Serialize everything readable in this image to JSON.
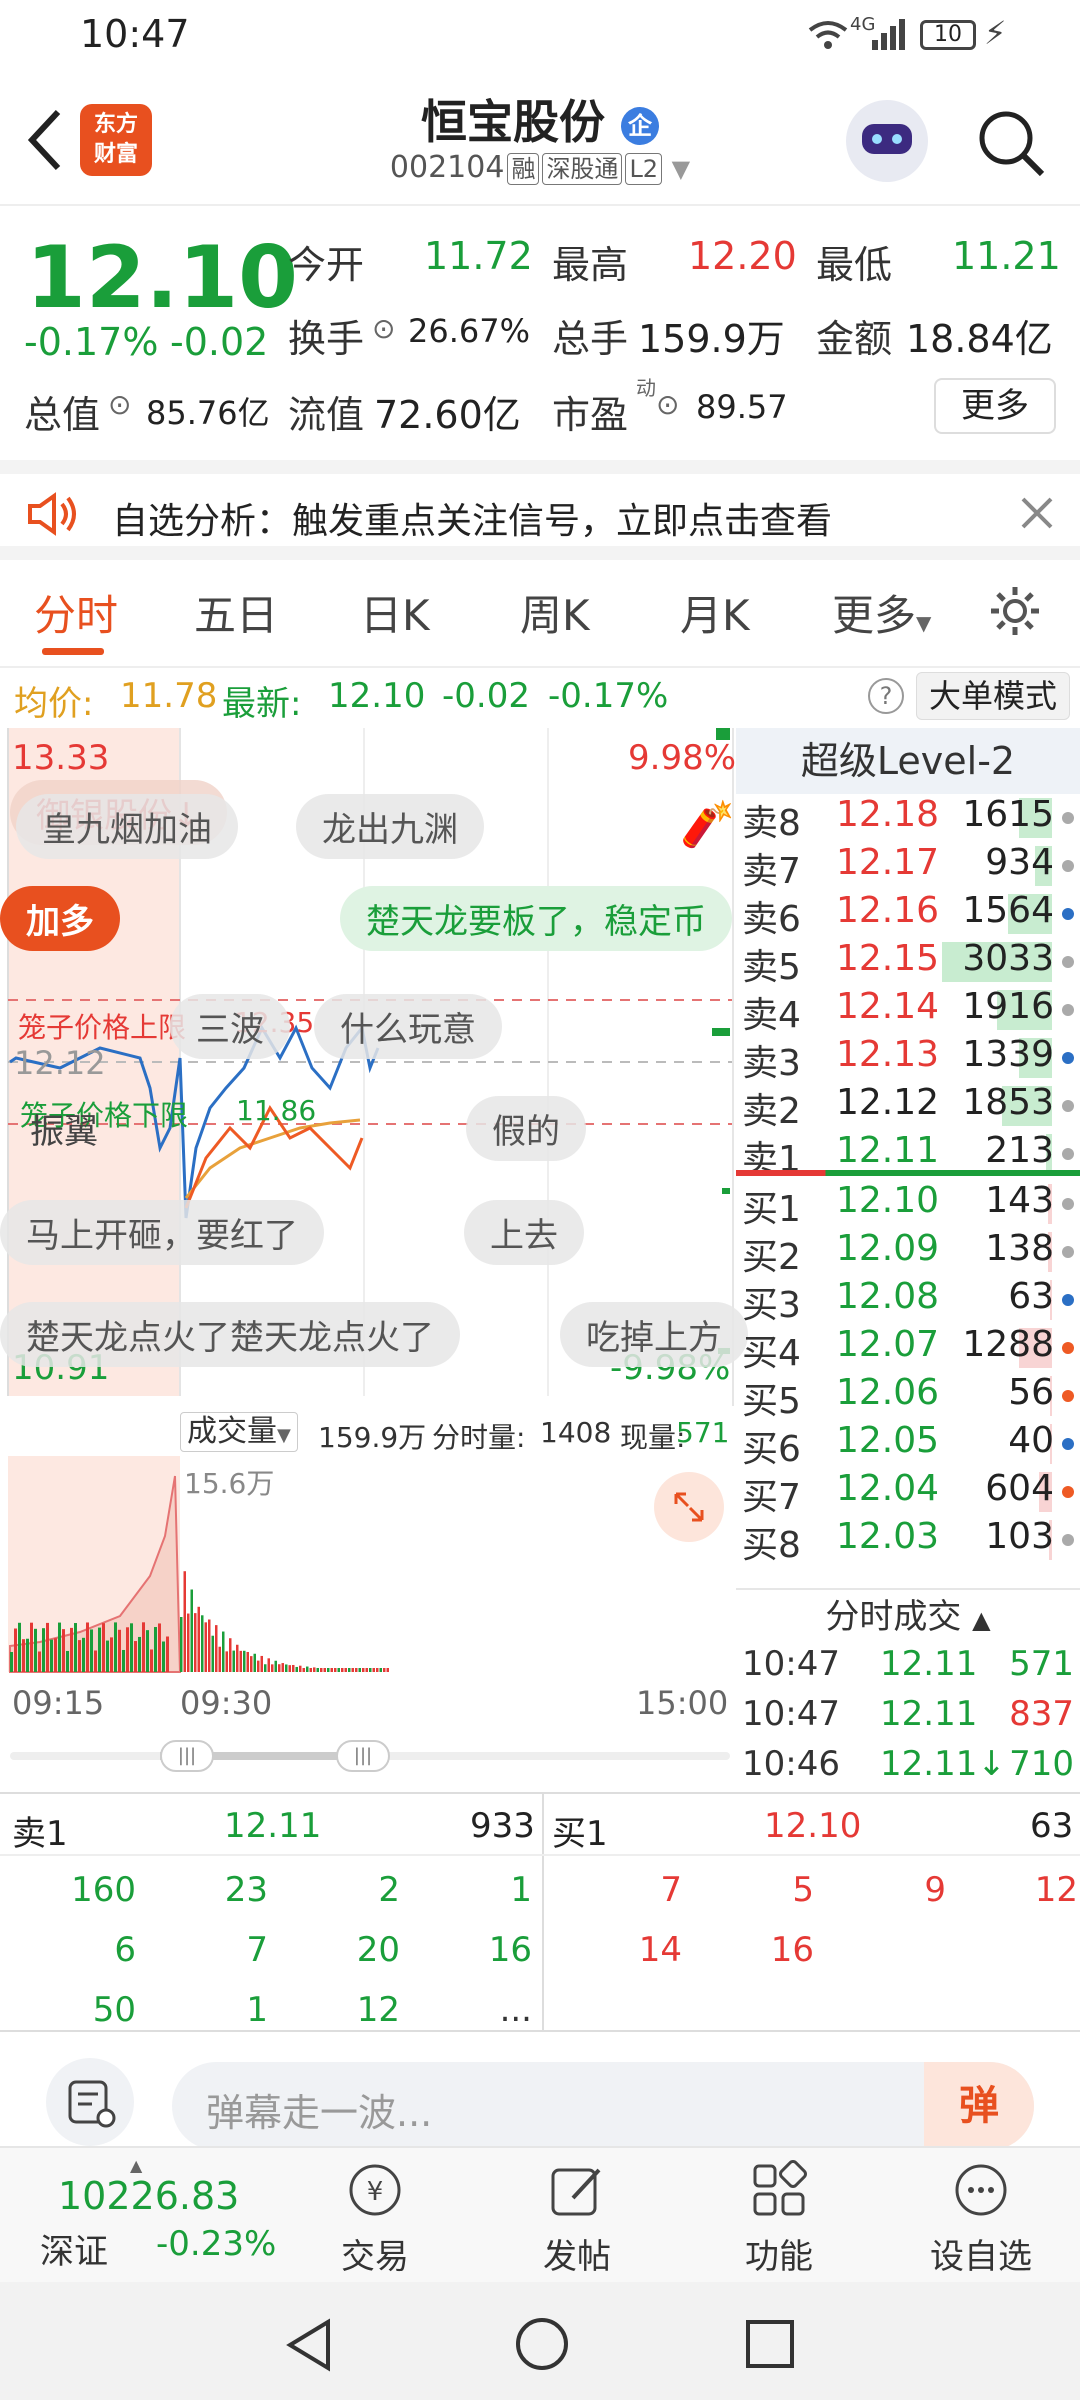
{
  "status_bar": {
    "time": "10:47",
    "network": "4G",
    "battery": "10"
  },
  "header": {
    "logo_text_1": "东方",
    "logo_text_2": "财富",
    "stock_name": "恒宝股份",
    "stock_badge": "企",
    "stock_code": "002104",
    "tags": [
      "融",
      "深股通",
      "L2"
    ]
  },
  "quote": {
    "price": "12.10",
    "change_pct": "-0.17%",
    "change": "-0.02",
    "open_label": "今开",
    "open": "11.72",
    "high_label": "最高",
    "high": "12.20",
    "low_label": "最低",
    "low": "11.21",
    "turnover_label": "换手",
    "turnover": "26.67%",
    "volume_label": "总手",
    "volume": "159.9万",
    "amount_label": "金额",
    "amount": "18.84亿",
    "mktcap_label": "总值",
    "mktcap": "85.76亿",
    "float_label": "流值",
    "float": "72.60亿",
    "pe_label": "市盈",
    "pe_sup": "动",
    "pe": "89.57",
    "more_button": "更多"
  },
  "banner": {
    "text": "自选分析：触发重点关注信号，立即点击查看"
  },
  "tabs": [
    "分时",
    "五日",
    "日K",
    "周K",
    "月K",
    "更多"
  ],
  "info_bar": {
    "avg_label": "均价:",
    "avg": "11.78",
    "latest_label": "最新:",
    "latest": "12.10",
    "latest_change": "-0.02",
    "latest_pct": "-0.17%",
    "mode_button": "大单模式"
  },
  "chart": {
    "top_price": "13.33",
    "top_pct": "9.98%",
    "bottom_price": "10.91",
    "bottom_pct": "-9.98%",
    "ref_price": "12.12",
    "upper_limit_label": "笼子价格上限",
    "upper_limit": "12.35",
    "lower_limit_label": "笼子价格下限",
    "lower_limit": "11.86",
    "danmu": [
      "御银股份↓",
      "皇九烟加油",
      "龙出九渊",
      "楚天龙要板了，稳定币",
      "加多",
      "三波",
      "什么玩意",
      "振翼",
      "假的",
      "马上开砸，要红了",
      "上去",
      "楚天龙点火了楚天龙点火了",
      "吃掉上方"
    ]
  },
  "volume_bar": {
    "label": "成交量",
    "total": "159.9万",
    "minute_label": "分时量:",
    "minute": "1408",
    "current_label": "现量:",
    "current": "571",
    "peak": "15.6万"
  },
  "time_axis": [
    "09:15",
    "09:30",
    "15:00"
  ],
  "level2": {
    "title": "超级Level-2",
    "asks": [
      {
        "label": "卖8",
        "price": "12.18",
        "qty": "1615",
        "share": 0.3
      },
      {
        "label": "卖7",
        "price": "12.17",
        "qty": "934",
        "share": 0.15
      },
      {
        "label": "卖6",
        "price": "12.16",
        "qty": "1564",
        "share": 0.4
      },
      {
        "label": "卖5",
        "price": "12.15",
        "qty": "3033",
        "share": 1.0
      },
      {
        "label": "卖4",
        "price": "12.14",
        "qty": "1916",
        "share": 0.5
      },
      {
        "label": "卖3",
        "price": "12.13",
        "qty": "1339",
        "share": 0.3
      },
      {
        "label": "卖2",
        "price": "12.12",
        "qty": "1853",
        "share": 0.45
      },
      {
        "label": "卖1",
        "price": "12.11",
        "qty": "213",
        "share": 0.05
      }
    ],
    "bids": [
      {
        "label": "买1",
        "price": "12.10",
        "qty": "143",
        "share": 0.04
      },
      {
        "label": "买2",
        "price": "12.09",
        "qty": "138",
        "share": 0.04
      },
      {
        "label": "买3",
        "price": "12.08",
        "qty": "63",
        "share": 0.02
      },
      {
        "label": "买4",
        "price": "12.07",
        "qty": "1288",
        "share": 0.3
      },
      {
        "label": "买5",
        "price": "12.06",
        "qty": "56",
        "share": 0.02
      },
      {
        "label": "买6",
        "price": "12.05",
        "qty": "40",
        "share": 0.02
      },
      {
        "label": "买7",
        "price": "12.04",
        "qty": "604",
        "share": 0.12
      },
      {
        "label": "买8",
        "price": "12.03",
        "qty": "103",
        "share": 0.03
      }
    ],
    "trades_title": "分时成交",
    "trades": [
      {
        "time": "10:47",
        "price": "12.11",
        "vol": "571"
      },
      {
        "time": "10:47",
        "price": "12.11",
        "vol": "837"
      },
      {
        "time": "10:46",
        "price": "12.11↓",
        "vol": "710"
      }
    ]
  },
  "queue": {
    "sell_label": "卖1",
    "sell_price": "12.11",
    "sell_total": "933",
    "buy_label": "买1",
    "buy_price": "12.10",
    "buy_total": "63",
    "sell_orders": [
      "160",
      "23",
      "2",
      "1",
      "6",
      "7",
      "20",
      "16",
      "50",
      "1",
      "12",
      "..."
    ],
    "buy_orders": [
      "7",
      "5",
      "9",
      "12",
      "14",
      "16"
    ]
  },
  "comment": {
    "placeholder": "弹幕走一波...",
    "send_icon": "弹"
  },
  "bottom_nav": {
    "index_value": "10226.83",
    "index_name": "深证",
    "index_change": "-0.23%",
    "items": [
      "交易",
      "发帖",
      "功能",
      "设自选"
    ]
  }
}
